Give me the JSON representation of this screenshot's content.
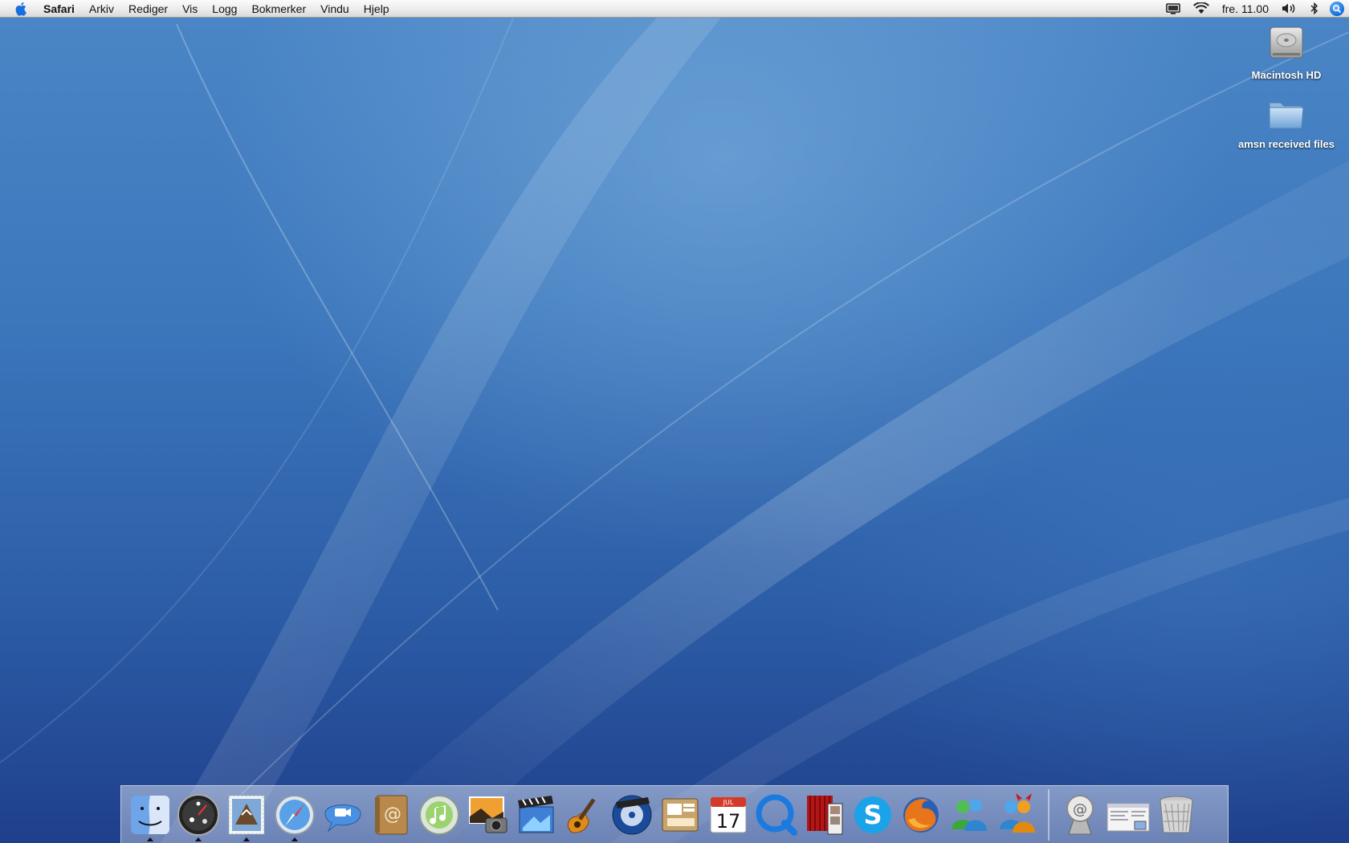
{
  "menubar": {
    "app_name": "Safari",
    "menus": [
      "Arkiv",
      "Rediger",
      "Vis",
      "Logg",
      "Bokmerker",
      "Vindu",
      "Hjelp"
    ],
    "clock": "fre. 11.00",
    "extras": [
      "display-icon",
      "wifi-icon",
      "volume-icon",
      "bluetooth-icon",
      "spotlight-icon"
    ]
  },
  "desktop": {
    "icons": [
      {
        "label": "Macintosh HD",
        "icon": "hard-drive-icon"
      },
      {
        "label": "amsn received files",
        "icon": "folder-icon"
      }
    ]
  },
  "dock": {
    "apps": [
      {
        "name": "finder-icon",
        "running": true
      },
      {
        "name": "dashboard-icon",
        "running": true
      },
      {
        "name": "mail-icon",
        "running": true
      },
      {
        "name": "safari-icon",
        "running": true
      },
      {
        "name": "ichat-icon",
        "running": false
      },
      {
        "name": "address-book-icon",
        "running": false
      },
      {
        "name": "itunes-icon",
        "running": false
      },
      {
        "name": "iphoto-icon",
        "running": false
      },
      {
        "name": "imovie-icon",
        "running": false
      },
      {
        "name": "garageband-icon",
        "running": false
      },
      {
        "name": "idvd-icon",
        "running": false
      },
      {
        "name": "iweb-icon",
        "running": false
      },
      {
        "name": "ical-icon",
        "running": false
      },
      {
        "name": "quicktime-icon",
        "running": false
      },
      {
        "name": "photo-booth-icon",
        "running": false
      },
      {
        "name": "skype-icon",
        "running": false
      },
      {
        "name": "firefox-icon",
        "running": false
      },
      {
        "name": "msn-messenger-icon",
        "running": false
      },
      {
        "name": "amsn-icon",
        "running": false
      }
    ],
    "ical_month": "JUL",
    "ical_day": "17",
    "others": [
      {
        "name": "email-stack-icon"
      },
      {
        "name": "document-stack-icon"
      },
      {
        "name": "trash-icon"
      }
    ]
  },
  "colors": {
    "wallpaper_top": "#4b86c6",
    "wallpaper_bottom": "#1f3f8c",
    "menubar": "#ececec",
    "spotlight": "#1268d8"
  }
}
